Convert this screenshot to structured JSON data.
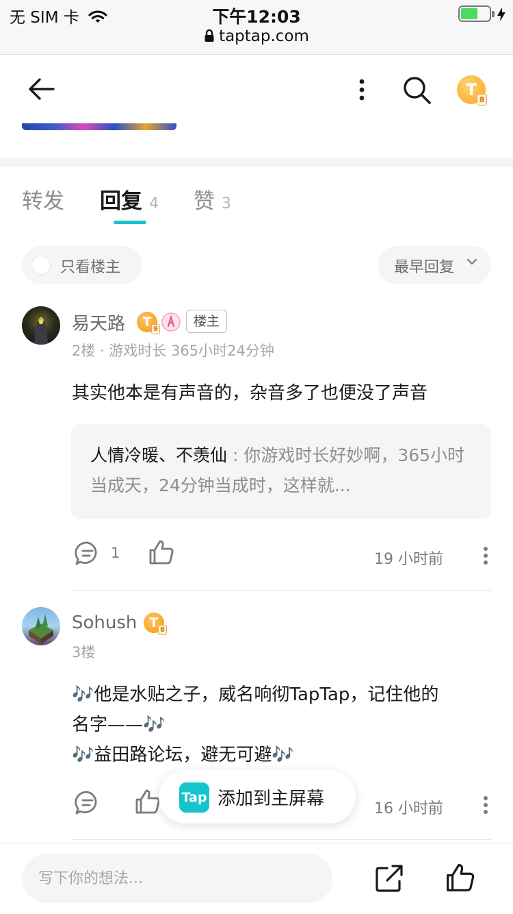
{
  "status_bar": {
    "carrier": "无 SIM 卡",
    "time": "下午12:03",
    "url": "taptap.com",
    "icons": [
      "wifi-icon",
      "lock-icon",
      "battery-icon",
      "charging-icon"
    ]
  },
  "header": {
    "icons": [
      "back-arrow-icon",
      "more-vertical-icon",
      "search-icon",
      "user-avatar"
    ],
    "avatar_badge": "T",
    "avatar_level": "8"
  },
  "tabs": [
    {
      "label": "转发",
      "count": ""
    },
    {
      "label": "回复",
      "count": "4"
    },
    {
      "label": "赞",
      "count": "3"
    }
  ],
  "active_tab": "回复",
  "accent_color": "#15c5ce",
  "filters": {
    "only_op_label": "只看楼主",
    "sort_label": "最早回复"
  },
  "comments": [
    {
      "username": "易天路",
      "badge_letter": "T",
      "badge_level": "9",
      "op_tag": "楼主",
      "meta": "2楼 · 游戏时长 365小时24分钟",
      "body": "其实他本是有声音的，杂音多了也便没了声音",
      "quote_author": "人情冷暖、不羡仙",
      "quote_sep": " : ",
      "quote_text": "你游戏时长好妙啊，365小时当成天，24分钟当成时，这样就...",
      "reply_count": "1",
      "time": "19 小时前"
    },
    {
      "username": "Sohush",
      "badge_letter": "T",
      "badge_level": "8",
      "meta": "3楼",
      "body_lines": [
        "🎶他是水贴之子，威名响彻TapTap，记住他的",
        "名字——🎶",
        "🎶益田路论坛，避无可避🎶"
      ],
      "reply_count": "",
      "time": "16 小时前"
    }
  ],
  "toast": {
    "app_icon_text": "Tap",
    "label": "添加到主屏幕"
  },
  "bottom_bar": {
    "placeholder": "写下你的想法...",
    "icons": [
      "share-icon",
      "like-icon"
    ]
  }
}
